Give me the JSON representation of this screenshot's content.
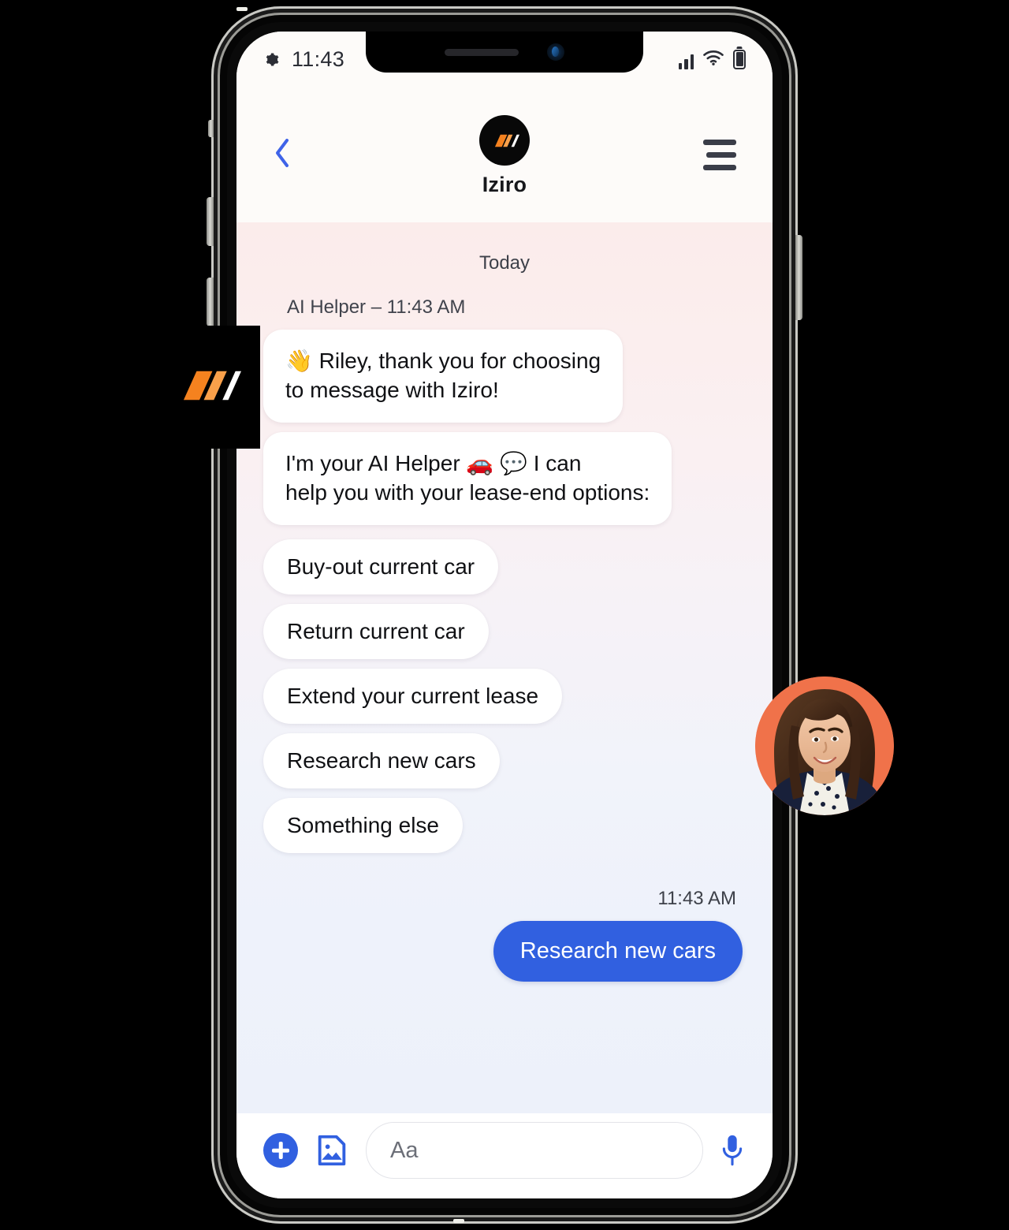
{
  "device": {
    "status_bar": {
      "settings_icon": "gear-icon",
      "time": "11:43",
      "signal_icon": "cellular-bars-icon",
      "wifi_icon": "wifi-icon",
      "battery_icon": "battery-full-icon"
    }
  },
  "header": {
    "back_icon": "chevron-left-icon",
    "brand_logo_icon": "iziro-logo-icon",
    "brand_name": "Iziro",
    "menu_icon": "hamburger-menu-icon"
  },
  "chat": {
    "day_separator": "Today",
    "incoming_meta": "AI Helper – 11:43 AM",
    "bubbles": [
      "👋 Riley, thank you for choosing\nto message with Iziro!",
      "I'm your AI Helper 🚗 💬 I can\nhelp you with your lease-end options:"
    ],
    "quick_replies": [
      "Buy-out current car",
      "Return current car",
      "Extend your current lease",
      "Research new cars",
      "Something else"
    ],
    "outgoing": {
      "time": "11:43 AM",
      "text": "Research new cars"
    },
    "avatar_alt": "agent-avatar"
  },
  "composer": {
    "add_icon": "plus-circle-icon",
    "image_icon": "image-attachment-icon",
    "input_placeholder": "Aa",
    "input_value": "",
    "mic_icon": "microphone-icon"
  },
  "branding": {
    "left_badge_icon": "iziro-logo-icon"
  },
  "colors": {
    "brand_orange": "#F5821F",
    "brand_orange_light": "#F9A04A",
    "accent_blue": "#3160E0",
    "avatar_bg": "#F0724A",
    "dark": "#080808"
  }
}
